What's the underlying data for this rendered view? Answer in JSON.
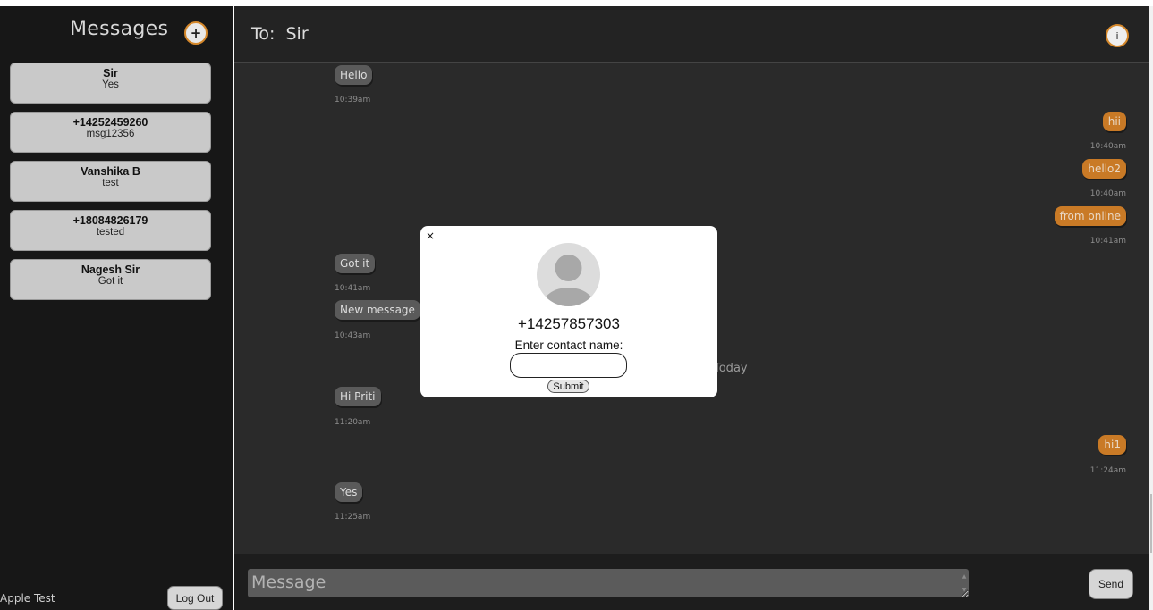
{
  "sidebar": {
    "title": "Messages",
    "new_button_icon": "+",
    "conversations": [
      {
        "name": "Sir",
        "preview": "Yes"
      },
      {
        "name": "+14252459260",
        "preview": "msg12356"
      },
      {
        "name": "Vanshika B",
        "preview": "test"
      },
      {
        "name": "+18084826179",
        "preview": "tested"
      },
      {
        "name": "Nagesh Sir",
        "preview": "Got it"
      }
    ],
    "user_name": "Apple Test",
    "logout_label": "Log Out"
  },
  "header": {
    "to_label": "To:  Sir",
    "info_icon": "i"
  },
  "thread": {
    "messages": [
      {
        "direction": "in",
        "text": "Hello",
        "time": "10:39am"
      },
      {
        "direction": "out",
        "text": "hii",
        "time": "10:40am"
      },
      {
        "direction": "out",
        "text": "hello2",
        "time": "10:40am"
      },
      {
        "direction": "out",
        "text": "from online",
        "time": "10:41am"
      },
      {
        "direction": "in",
        "text": "Got it",
        "time": "10:41am"
      },
      {
        "direction": "in",
        "text": "New message",
        "time": "10:43am"
      },
      {
        "direction": "in",
        "text": "Hi Priti",
        "time": "11:20am"
      },
      {
        "direction": "out",
        "text": "hi1",
        "time": "11:24am"
      },
      {
        "direction": "in",
        "text": "Yes",
        "time": "11:25am"
      }
    ],
    "day_separator": "Today"
  },
  "composer": {
    "placeholder": "Message",
    "send_label": "Send"
  },
  "modal": {
    "close_icon": "×",
    "phone_number": "+14257857303",
    "prompt": "Enter contact name:",
    "input_value": "",
    "submit_label": "Submit"
  },
  "colors": {
    "accent": "#c97a26",
    "sidebar_bg": "#171717",
    "thread_bg": "#2a2a2a",
    "incoming_bubble": "#5a5a5a"
  }
}
